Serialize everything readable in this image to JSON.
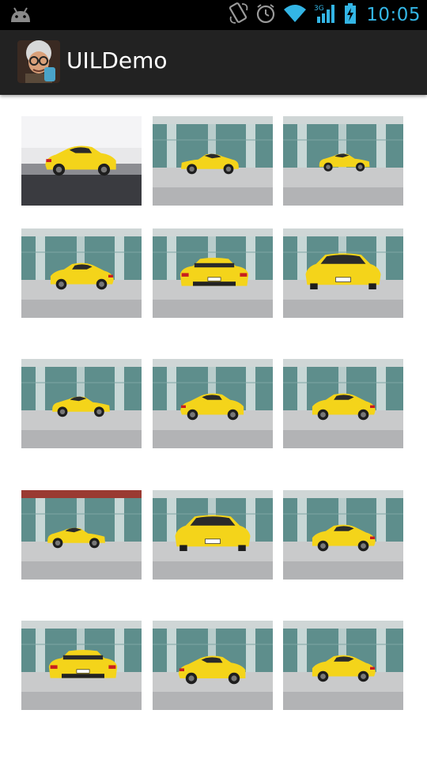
{
  "status_bar": {
    "time": "10:05",
    "network_label": "3G",
    "icons": [
      "android-icon",
      "rotation-lock-icon",
      "alarm-icon",
      "wifi-icon",
      "signal-icon",
      "battery-icon"
    ]
  },
  "action_bar": {
    "title": "UILDemo",
    "icon": "app-avatar-icon"
  },
  "grid": {
    "columns": 3,
    "rows": 5,
    "items": [
      {
        "label": "car-photo-1",
        "scene": "studio-rear"
      },
      {
        "label": "car-photo-2",
        "scene": "side-right"
      },
      {
        "label": "car-photo-3",
        "scene": "side-left-far"
      },
      {
        "label": "car-photo-4",
        "scene": "rear-three-quarter"
      },
      {
        "label": "car-photo-5",
        "scene": "rear"
      },
      {
        "label": "car-photo-6",
        "scene": "front"
      },
      {
        "label": "car-photo-7",
        "scene": "side-left"
      },
      {
        "label": "car-photo-8",
        "scene": "rear-three-quarter-left"
      },
      {
        "label": "car-photo-9",
        "scene": "front-three-quarter"
      },
      {
        "label": "car-photo-10",
        "scene": "side-left-red-roof"
      },
      {
        "label": "car-photo-11",
        "scene": "front"
      },
      {
        "label": "car-photo-12",
        "scene": "front-three-quarter"
      },
      {
        "label": "car-photo-13",
        "scene": "rear"
      },
      {
        "label": "car-photo-14",
        "scene": "front-three-quarter-right"
      },
      {
        "label": "car-photo-15",
        "scene": "rear-three-quarter"
      }
    ]
  },
  "colors": {
    "status_bar_bg": "#000000",
    "status_icon": "#33b5e5",
    "action_bar_bg": "#222222",
    "title_text": "#ffffff",
    "car_yellow": "#f4d41a",
    "glass_teal": "#5e8e8c"
  }
}
